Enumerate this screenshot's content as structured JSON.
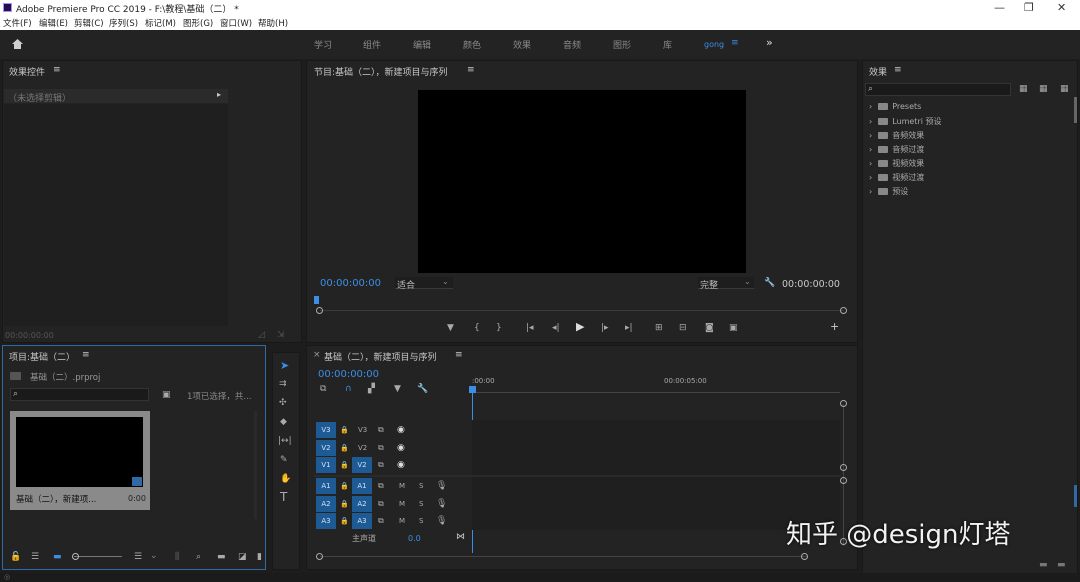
{
  "window": {
    "title": "Adobe Premiere Pro CC 2019 - F:\\教程\\基础（二） *",
    "controls": [
      "—",
      "❐",
      "✕"
    ]
  },
  "menu": [
    "文件(F)",
    "编辑(E)",
    "剪辑(C)",
    "序列(S)",
    "标记(M)",
    "图形(G)",
    "窗口(W)",
    "帮助(H)"
  ],
  "workspaces": {
    "tabs": [
      "学习",
      "组件",
      "编辑",
      "颜色",
      "效果",
      "音频",
      "图形",
      "库",
      "gong"
    ],
    "active": "gong",
    "menu_glyph": "≡",
    "overflow": "»"
  },
  "effect_controls": {
    "title": "效果控件",
    "menu_glyph": "≡",
    "no_clip": "（未选择剪辑）",
    "timecode": "00:00:00:00"
  },
  "program_monitor": {
    "title": "节目:基础（二），新建项目与序列",
    "menu_glyph": "≡",
    "timecode": "00:00:00:00",
    "zoom": "适合",
    "resolution": "完整",
    "duration": "00:00:00:00"
  },
  "project": {
    "title": "项目:基础（二）",
    "menu_glyph": "≡",
    "file": "基础（二）.prproj",
    "search_placeholder": "",
    "selection": "1项已选择，共...",
    "clip_name": "基础（二），新建项...",
    "clip_duration": "0:00"
  },
  "effects": {
    "title": "效果",
    "menu_glyph": "≡",
    "items": [
      "Presets",
      "Lumetri 预设",
      "音频效果",
      "音频过渡",
      "视频效果",
      "视频过渡",
      "预设"
    ]
  },
  "timeline": {
    "title": "基础（二），新建项目与序列",
    "close": "×",
    "menu_glyph": "≡",
    "timecode": "00:00:00:00",
    "ruler": [
      ":00:00",
      "00:00:05:00"
    ],
    "video_tracks": [
      {
        "src": "V3",
        "label": "V3"
      },
      {
        "src": "V2",
        "label": "V2"
      },
      {
        "src": "V1",
        "label": "V2"
      }
    ],
    "audio_tracks": [
      {
        "src": "A1",
        "label": "A1"
      },
      {
        "src": "A2",
        "label": "A2"
      },
      {
        "src": "A3",
        "label": "A3"
      }
    ],
    "master_label": "主声道",
    "master_value": "0.0",
    "mute": "M",
    "solo": "S"
  },
  "watermark": "知乎 @design灯塔"
}
